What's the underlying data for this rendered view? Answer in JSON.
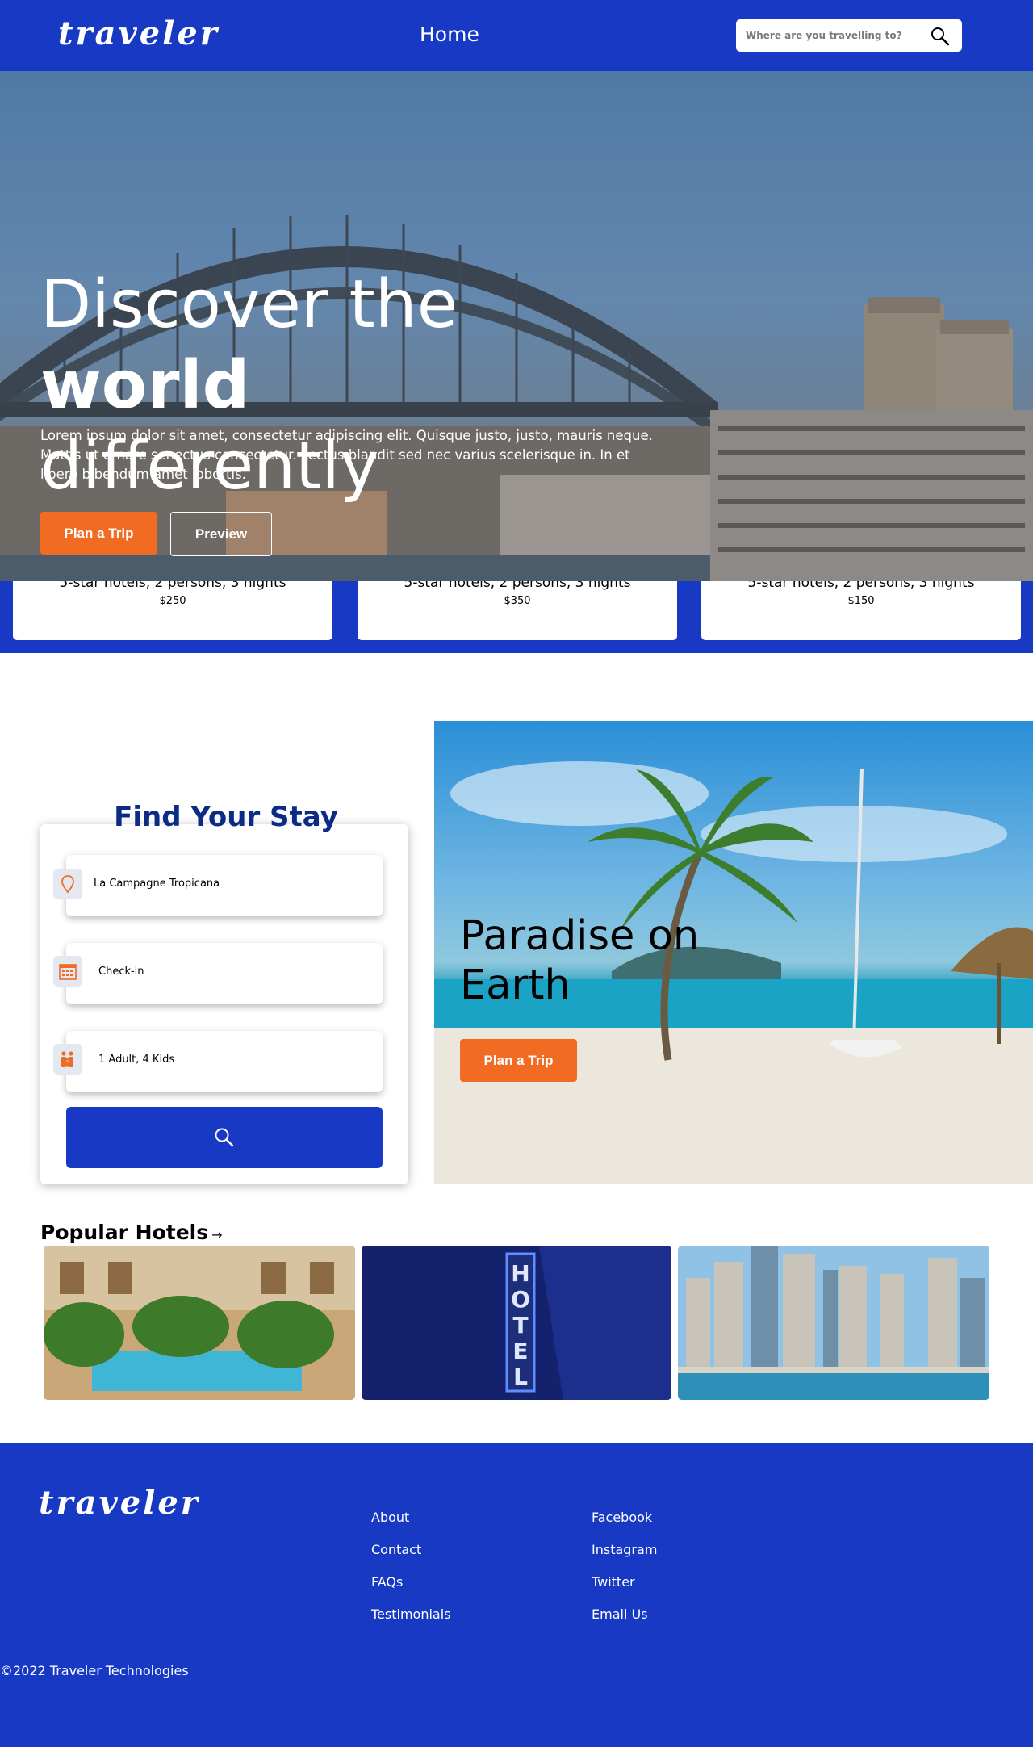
{
  "header": {
    "logo": "traveler",
    "nav_home": "Home",
    "search_placeholder": "Where are you travelling to?"
  },
  "hero": {
    "title_part1": "Discover the ",
    "title_part2": "world",
    "title_part3": "differently",
    "text": "Lorem ipsum dolor sit amet, consectetur adipiscing elit. Quisque justo, justo, mauris neque. Mattis ut ornare senectus consectetur. Lectus blandit sed nec varius scelerisque in. In et libero bibendum amet lobortis.",
    "plan_button": "Plan a Trip",
    "preview_button": "Preview"
  },
  "deals": [
    {
      "desc": "5-star hotels, 2 persons, 3 nights",
      "price": "$250"
    },
    {
      "desc": "5-star hotels, 2 persons, 3 nights",
      "price": "$350"
    },
    {
      "desc": "5-star hotels, 2 persons, 3 nights",
      "price": "$150"
    }
  ],
  "find_stay": {
    "title": "Find Your Stay",
    "location": "La Campagne Tropicana",
    "checkin": "Check-in",
    "guests": "1 Adult, 4 Kids"
  },
  "paradise": {
    "title": "Paradise on Earth",
    "plan_button": "Plan a Trip"
  },
  "popular": {
    "title": "Popular Hotels",
    "arrow": "→"
  },
  "footer": {
    "logo": "traveler",
    "col1": [
      "About",
      "Contact",
      "FAQs",
      "Testimonials"
    ],
    "col2": [
      "Facebook",
      "Instagram",
      "Twitter",
      "Email Us"
    ],
    "copyright": "©2022 Traveler Technologies"
  },
  "colors": {
    "brand_blue": "#1739c4",
    "accent_orange": "#f26b22",
    "title_navy": "#0c2b84"
  }
}
